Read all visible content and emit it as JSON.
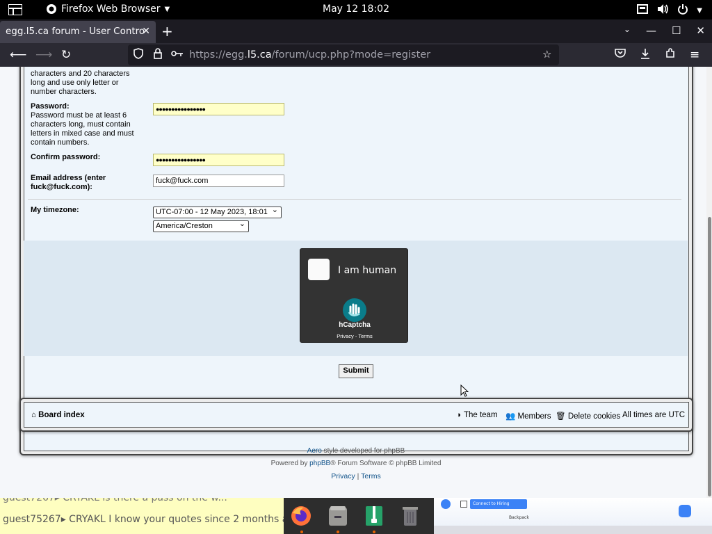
{
  "topbar": {
    "app_name": "Firefox Web Browser",
    "clock": "May 12  18:02"
  },
  "browser": {
    "tab_title": "egg.l5.ca forum - User Contro",
    "url_prefix": "https://egg.",
    "url_domain": "l5.ca",
    "url_path": "/forum/ucp.php?mode=register"
  },
  "form": {
    "username_hint_tail": "characters and 20 characters long and use only letter or number characters.",
    "password_label": "Password:",
    "password_hint": "Password must be at least 6 characters long, must contain letters in mixed case and must contain numbers.",
    "password_value": "●●●●●●●●●●●●●●●●",
    "confirm_label": "Confirm password:",
    "confirm_value": "●●●●●●●●●●●●●●●●",
    "email_label": "Email address (enter fuck@fuck.com):",
    "email_value": "fuck@fuck.com",
    "timezone_label": "My timezone:",
    "timezone_offset": "UTC-07:00 - 12 May 2023, 18:01",
    "timezone_zone": "America/Creston",
    "captcha_label": "I am human",
    "captcha_brand": "hCaptcha",
    "captcha_links": "Privacy - Terms",
    "submit_label": "Submit"
  },
  "footer": {
    "board_index": "Board index",
    "the_team": "The team",
    "members": "Members",
    "delete_cookies": "Delete cookies",
    "times": "All times are UTC",
    "style_link": "Aero",
    "style_text": " style developed for phpBB",
    "powered_prefix": "Powered by ",
    "powered_link": "phpBB",
    "powered_suffix": "® Forum Software © phpBB Limited",
    "privacy": "Privacy",
    "separator": " | ",
    "terms": "Terms"
  },
  "chat": {
    "line1": "guest7267▸ CRYAKL is there a pass on the w...",
    "line2": "guest75267▸ CRYAKL I know your quotes since 2 months ago"
  },
  "preview": {
    "button": "Connect to Hiring",
    "caption": "Backpack"
  }
}
